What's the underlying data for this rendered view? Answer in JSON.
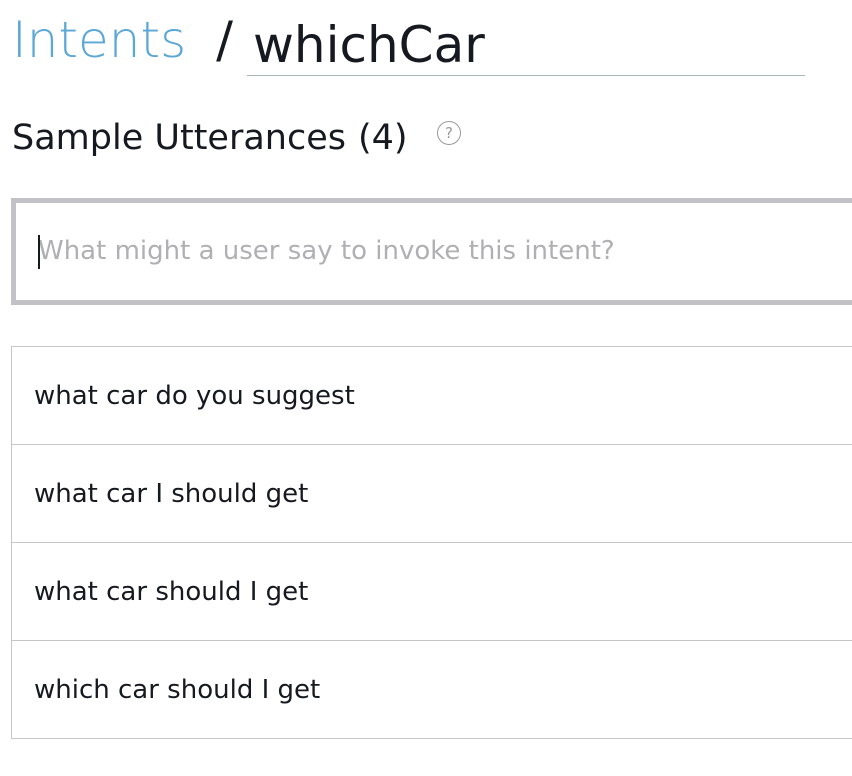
{
  "breadcrumb": {
    "parent_label": "Intents",
    "separator": "/",
    "intent_name": "whichCar"
  },
  "section": {
    "title": "Sample Utterances",
    "count": "(4)",
    "help_icon": "question-circle-icon"
  },
  "input": {
    "placeholder": "What might a user say to invoke this intent?",
    "value": ""
  },
  "utterances": [
    {
      "text": "what car do you suggest"
    },
    {
      "text": "what car I should get"
    },
    {
      "text": "what car should I get"
    },
    {
      "text": "which car should I get"
    }
  ],
  "colors": {
    "link": "#5ba7d6",
    "text": "#16191f",
    "border": "#c6c6c6",
    "input_border": "#c2c2c6"
  }
}
